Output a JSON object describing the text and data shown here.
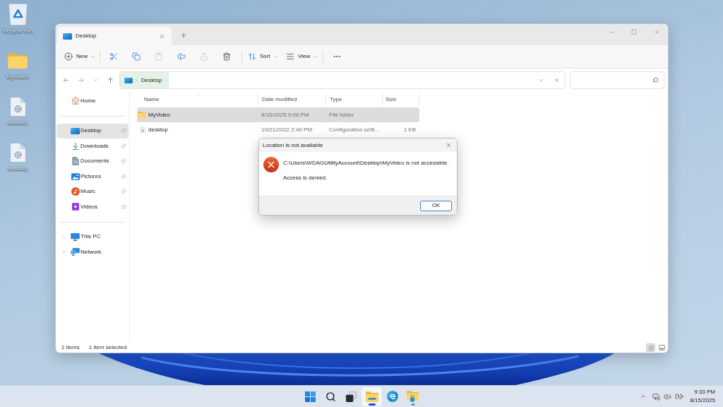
{
  "desktop": {
    "icons": [
      {
        "label": "Recycle Bin",
        "kind": "recycle_bin"
      },
      {
        "label": "MyVideo",
        "kind": "folder"
      },
      {
        "label": "desktop",
        "kind": "settings_file"
      },
      {
        "label": "desktop",
        "kind": "settings_file"
      }
    ]
  },
  "explorer": {
    "tabs": [
      {
        "title": "Desktop",
        "selected": true
      }
    ],
    "toolbar": [
      {
        "kind": "new",
        "label": "New",
        "disabled": false
      },
      {
        "kind": "separator"
      },
      {
        "kind": "cut",
        "disabled": false
      },
      {
        "kind": "copy",
        "disabled": false
      },
      {
        "kind": "paste",
        "disabled": true
      },
      {
        "kind": "rename",
        "disabled": false
      },
      {
        "kind": "share",
        "disabled": true
      },
      {
        "kind": "delete",
        "disabled": false
      },
      {
        "kind": "separator"
      },
      {
        "kind": "sort",
        "label": "Sort",
        "disabled": false
      },
      {
        "kind": "view",
        "label": "View",
        "disabled": false
      },
      {
        "kind": "separator"
      },
      {
        "kind": "more",
        "disabled": false
      }
    ],
    "address_bar": {
      "breadcrumb": [
        {
          "label": "Desktop"
        }
      ]
    },
    "nav_pane": {
      "groups": [
        {
          "items": [
            {
              "label": "Home",
              "kind": "home",
              "selected": false
            }
          ]
        },
        {
          "items": [
            {
              "label": "Desktop",
              "kind": "desktop",
              "selected": true,
              "pinned": true
            },
            {
              "label": "Downloads",
              "kind": "downloads",
              "selected": false,
              "pinned": true
            },
            {
              "label": "Documents",
              "kind": "documents",
              "selected": false,
              "pinned": true
            },
            {
              "label": "Pictures",
              "kind": "pictures",
              "selected": false,
              "pinned": true
            },
            {
              "label": "Music",
              "kind": "music",
              "selected": false,
              "pinned": true
            },
            {
              "label": "Videos",
              "kind": "videos",
              "selected": false,
              "pinned": true
            }
          ]
        },
        {
          "items": [
            {
              "label": "This PC",
              "kind": "this_pc",
              "selected": false,
              "expanded": false
            },
            {
              "label": "Network",
              "kind": "network",
              "selected": false,
              "expanded": false
            }
          ]
        }
      ]
    },
    "file_list": {
      "columns": [
        {
          "label": "Name",
          "sorted": true
        },
        {
          "label": "Date modified",
          "sorted": false
        },
        {
          "label": "Type",
          "sorted": false
        },
        {
          "label": "Size",
          "sorted": false
        }
      ],
      "rows": [
        {
          "name": "MyVideo",
          "kind": "folder",
          "date_modified": "8/15/2025 9:06 PM",
          "type": "File folder",
          "selected": true
        },
        {
          "name": "desktop",
          "kind": "settings_file",
          "date_modified": "10/21/2022 2:40 PM",
          "type": "Configuration setti…",
          "size": "1 KB",
          "selected": false
        }
      ]
    },
    "status_bar": {
      "item_count": "2 items",
      "selection": "1 item selected",
      "view_buttons": [
        {
          "kind": "details",
          "selected": true
        },
        {
          "kind": "tiles",
          "selected": false
        }
      ]
    }
  },
  "dialog": {
    "title": "Location is not available",
    "kind": "error",
    "message": "C:\\Users\\WDAGUtilityAccount\\Desktop\\MyVideo is not accessible.",
    "detail": "Access is denied.",
    "buttons": [
      {
        "label": "OK",
        "default": true
      }
    ]
  },
  "taskbar": {
    "apps": [
      {
        "kind": "start",
        "running": false,
        "active": false
      },
      {
        "kind": "search",
        "running": false,
        "active": false
      },
      {
        "kind": "task_view",
        "running": false,
        "active": false
      },
      {
        "kind": "file_explorer",
        "running": true,
        "active": true
      },
      {
        "kind": "edge",
        "running": false,
        "active": false
      },
      {
        "kind": "locked_folder",
        "running": true,
        "active": false
      }
    ],
    "clock": {
      "time": "9:33 PM",
      "date": "8/15/2025"
    }
  }
}
